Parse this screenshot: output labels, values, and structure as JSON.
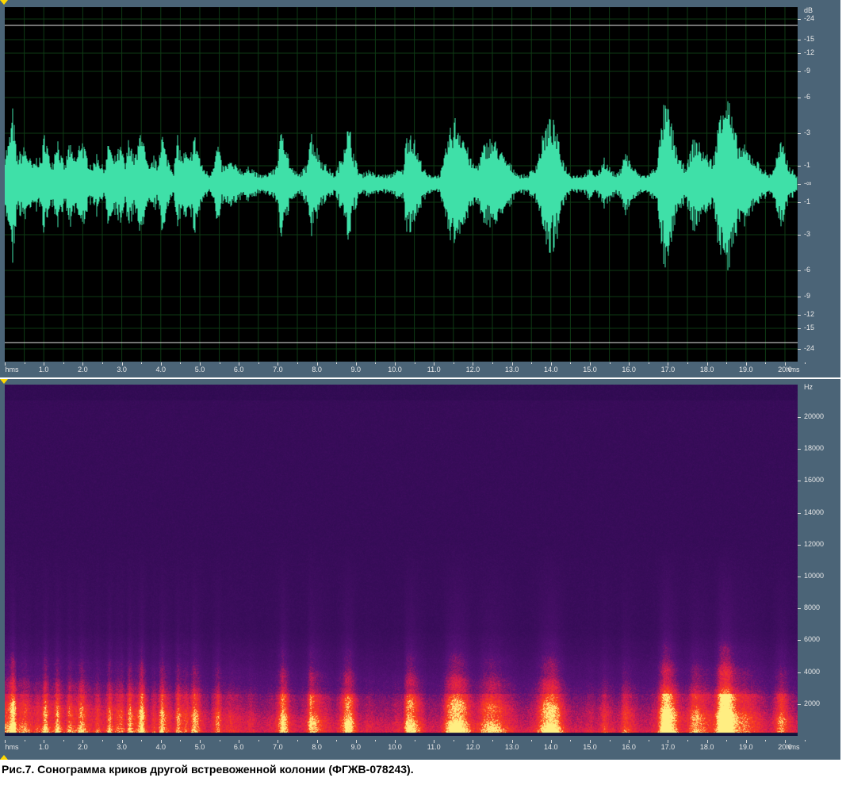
{
  "waveform": {
    "db_unit": "dB",
    "db_scale_top": [
      "-1",
      "-3",
      "-6",
      "-9",
      "-12",
      "-15",
      "-24"
    ],
    "db_center": "-∞",
    "db_scale_bottom": [
      "-24",
      "-15",
      "-12",
      "-9",
      "-6",
      "-3",
      "-1"
    ],
    "wave_color": "#3fe0a8",
    "envelope": [
      0.35,
      0.45,
      0.8,
      0.3,
      0.35,
      0.4,
      0.3,
      0.2,
      0.3,
      0.25,
      0.6,
      0.3,
      0.25,
      0.55,
      0.3,
      0.2,
      0.45,
      0.3,
      0.3,
      0.55,
      0.35,
      0.25,
      0.2,
      0.35,
      0.2,
      0.2,
      0.5,
      0.25,
      0.35,
      0.4,
      0.2,
      0.55,
      0.3,
      0.35,
      0.7,
      0.3,
      0.15,
      0.3,
      0.2,
      0.6,
      0.35,
      0.25,
      0.15,
      0.5,
      0.3,
      0.35,
      0.25,
      0.55,
      0.4,
      0.2,
      0.15,
      0.1,
      0.25,
      0.45,
      0.2,
      0.2,
      0.25,
      0.2,
      0.2,
      0.15,
      0.15,
      0.2,
      0.15,
      0.1,
      0.1,
      0.1,
      0.15,
      0.15,
      0.3,
      0.65,
      0.45,
      0.2,
      0.15,
      0.1,
      0.15,
      0.2,
      0.6,
      0.45,
      0.35,
      0.25,
      0.2,
      0.15,
      0.1,
      0.2,
      0.35,
      0.6,
      0.55,
      0.3,
      0.15,
      0.1,
      0.15,
      0.15,
      0.1,
      0.1,
      0.1,
      0.1,
      0.1,
      0.15,
      0.15,
      0.15,
      0.55,
      0.6,
      0.45,
      0.3,
      0.2,
      0.1,
      0.1,
      0.1,
      0.1,
      0.2,
      0.45,
      0.6,
      0.7,
      0.65,
      0.55,
      0.4,
      0.25,
      0.2,
      0.25,
      0.4,
      0.45,
      0.5,
      0.45,
      0.4,
      0.3,
      0.25,
      0.2,
      0.15,
      0.1,
      0.1,
      0.1,
      0.15,
      0.2,
      0.35,
      0.55,
      0.65,
      0.7,
      0.6,
      0.4,
      0.25,
      0.15,
      0.1,
      0.1,
      0.1,
      0.1,
      0.15,
      0.15,
      0.1,
      0.15,
      0.3,
      0.2,
      0.15,
      0.1,
      0.15,
      0.35,
      0.3,
      0.2,
      0.15,
      0.1,
      0.1,
      0.1,
      0.15,
      0.2,
      0.5,
      0.85,
      0.8,
      0.6,
      0.4,
      0.25,
      0.2,
      0.25,
      0.45,
      0.5,
      0.4,
      0.35,
      0.3,
      0.25,
      0.45,
      0.9,
      1.0,
      0.95,
      0.65,
      0.5,
      0.4,
      0.4,
      0.35,
      0.3,
      0.25,
      0.2,
      0.15,
      0.1,
      0.15,
      0.3,
      0.45,
      0.35,
      0.2,
      0.15,
      0.1
    ]
  },
  "time_axis": {
    "unit": "hms",
    "ticks": [
      "1.0",
      "2.0",
      "3.0",
      "4.0",
      "5.0",
      "6.0",
      "7.0",
      "8.0",
      "9.0",
      "10.0",
      "11.0",
      "12.0",
      "13.0",
      "14.0",
      "15.0",
      "16.0",
      "17.0",
      "18.0",
      "19.0",
      "20.0"
    ]
  },
  "spectrogram": {
    "freq_unit": "Hz",
    "freq_ticks": [
      "20000",
      "18000",
      "16000",
      "14000",
      "12000",
      "10000",
      "8000",
      "6000",
      "4000",
      "2000"
    ],
    "base_color": "#3a1258",
    "hot_color": "#ff2a12",
    "peak_color": "#ffe08a"
  },
  "caption": "Рис.7. Сонограмма криков другой встревоженной колонии (ФГЖВ-078243)."
}
